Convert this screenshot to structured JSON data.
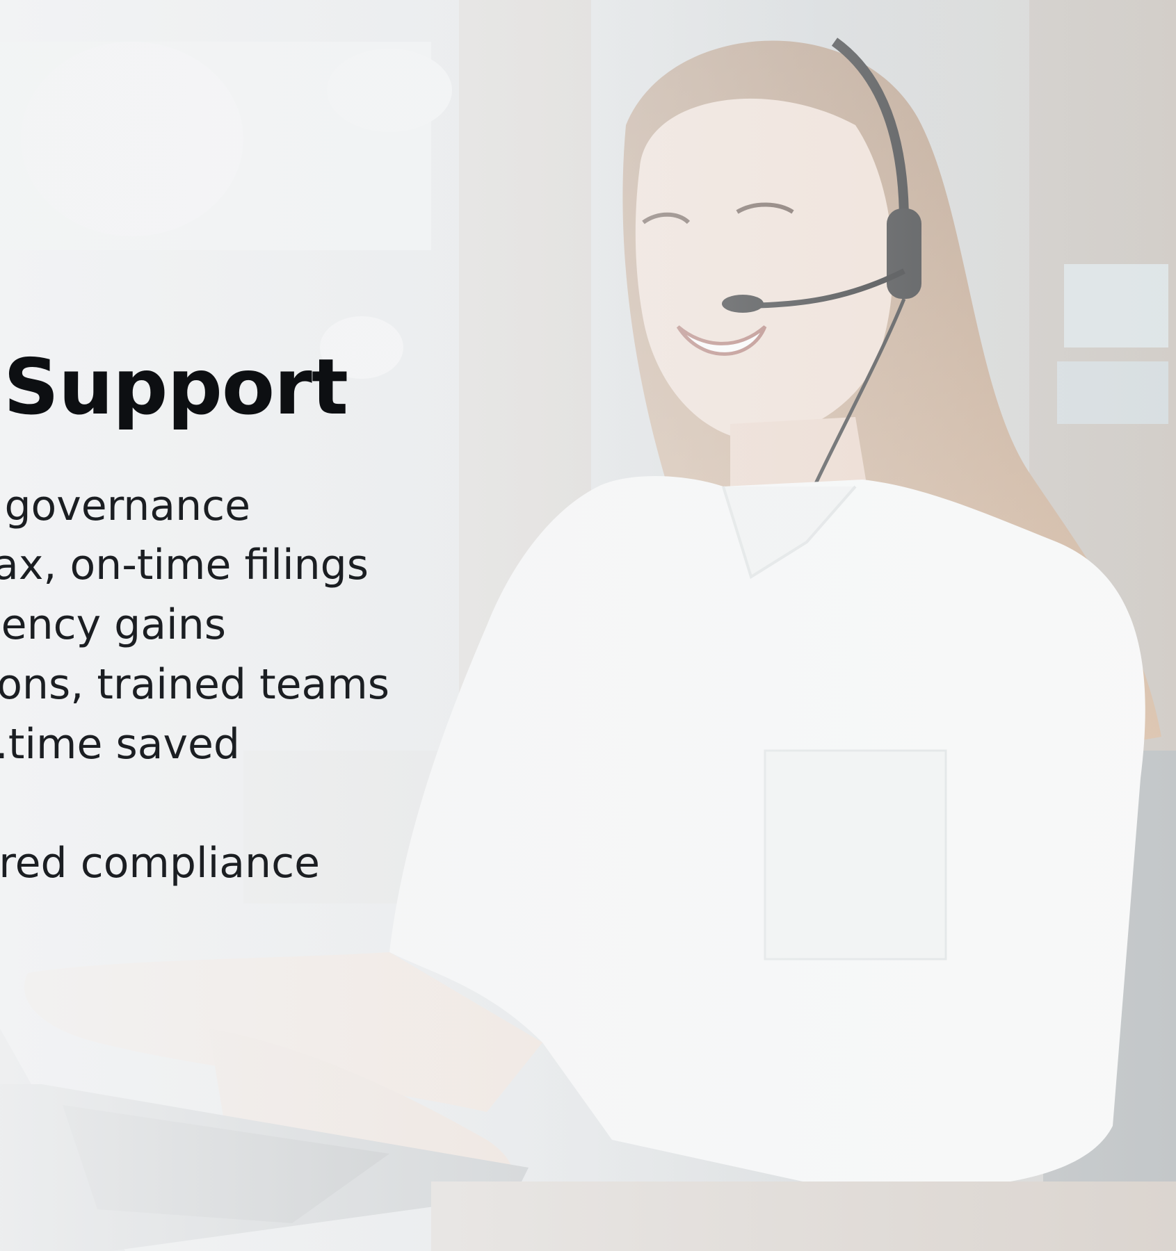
{
  "hero": {
    "headline": "Support",
    "photo_alt": "Woman wearing a headset typing on a laptop"
  },
  "bullets": [
    {
      "text": "governance."
    },
    {
      "text": "ax, on-time filings."
    },
    {
      "text": "ency gains."
    },
    {
      "text": "ons, trained teams."
    },
    {
      "text": "time saved."
    }
  ],
  "footer_line": "red compliance",
  "colors": {
    "text": "#0d0f12",
    "overlay": "#f4f5f6",
    "shirt": "#f7f8f8",
    "hair": "#c9a585"
  }
}
